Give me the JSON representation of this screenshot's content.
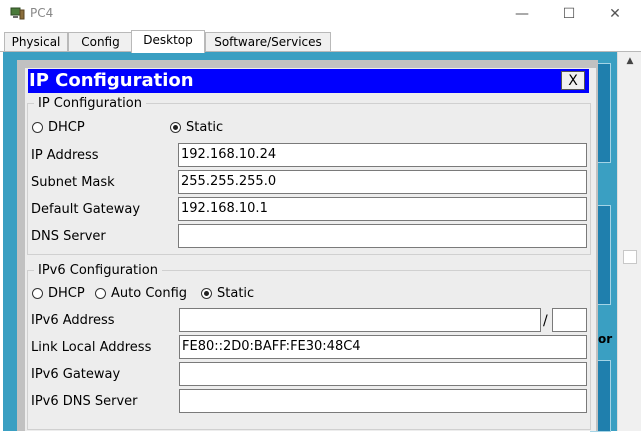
{
  "window": {
    "title": "PC4",
    "minimize_glyph": "—",
    "maximize_glyph": "☐",
    "close_glyph": "✕"
  },
  "tabs": [
    {
      "label": "Physical"
    },
    {
      "label": "Config"
    },
    {
      "label": "Desktop",
      "active": true
    },
    {
      "label": "Software/Services"
    }
  ],
  "background": {
    "partial_text": "or"
  },
  "scrollbar": {
    "up_glyph": "▲"
  },
  "ip_config": {
    "title": "IP Configuration",
    "close_label": "X",
    "ipv4": {
      "group_title": "IP Configuration",
      "dhcp_label": "DHCP",
      "static_label": "Static",
      "selected_mode": "Static",
      "ip_address_label": "IP Address",
      "ip_address": "192.168.10.24",
      "subnet_mask_label": "Subnet Mask",
      "subnet_mask": "255.255.255.0",
      "default_gateway_label": "Default Gateway",
      "default_gateway": "192.168.10.1",
      "dns_server_label": "DNS Server",
      "dns_server": ""
    },
    "ipv6": {
      "group_title": "IPv6 Configuration",
      "dhcp_label": "DHCP",
      "auto_config_label": "Auto Config",
      "static_label": "Static",
      "selected_mode": "Static",
      "ipv6_address_label": "IPv6 Address",
      "ipv6_address": "",
      "prefix_separator": "/",
      "prefix_length": "",
      "link_local_label": "Link Local Address",
      "link_local_address": "FE80::2D0:BAFF:FE30:48C4",
      "ipv6_gateway_label": "IPv6 Gateway",
      "ipv6_gateway": "",
      "ipv6_dns_label": "IPv6 DNS Server",
      "ipv6_dns": ""
    }
  },
  "colors": {
    "header_bar": "#0000ff",
    "desktop_bg": "#3a9fc2",
    "dialog_bg": "#ededed"
  },
  "icons": {
    "app": "pc-icon"
  }
}
